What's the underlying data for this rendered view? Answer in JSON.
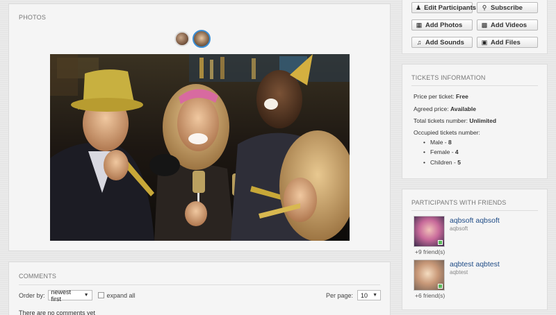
{
  "photos": {
    "title": "PHOTOS",
    "thumbnails": [
      {
        "name": "photo-thumb-1",
        "active": false
      },
      {
        "name": "photo-thumb-2",
        "active": true
      }
    ]
  },
  "comments": {
    "title": "COMMENTS",
    "order_label": "Order by:",
    "order_value": "newest first",
    "expand_label": "expand all",
    "per_page_label": "Per page:",
    "per_page_value": "10",
    "empty_text": "There are no comments yet"
  },
  "actions": {
    "edit_participants": "Edit Participants",
    "subscribe": "Subscribe",
    "add_photos": "Add Photos",
    "add_videos": "Add Videos",
    "add_sounds": "Add Sounds",
    "add_files": "Add Files"
  },
  "tickets": {
    "title": "TICKETS INFORMATION",
    "price_label": "Price per ticket:",
    "price_value": "Free",
    "agreed_label": "Agreed price:",
    "agreed_value": "Available",
    "total_label": "Total tickets number:",
    "total_value": "Unlimited",
    "occupied_label": "Occupied tickets number:",
    "male_label": "Male -",
    "male_value": "8",
    "female_label": "Female -",
    "female_value": "4",
    "children_label": "Children -",
    "children_value": "5"
  },
  "participants": {
    "title": "PARTICIPANTS WITH FRIENDS",
    "list": [
      {
        "name": "aqbsoft aqbsoft",
        "username": "aqbsoft",
        "friends": "+9 friend(s)"
      },
      {
        "name": "aqbtest aqbtest",
        "username": "aqbtest",
        "friends": "+6 friend(s)"
      }
    ]
  },
  "colors": {
    "link": "#1e4b86",
    "online": "#5bb85b",
    "active_thumb_border": "#3b8fd6"
  }
}
